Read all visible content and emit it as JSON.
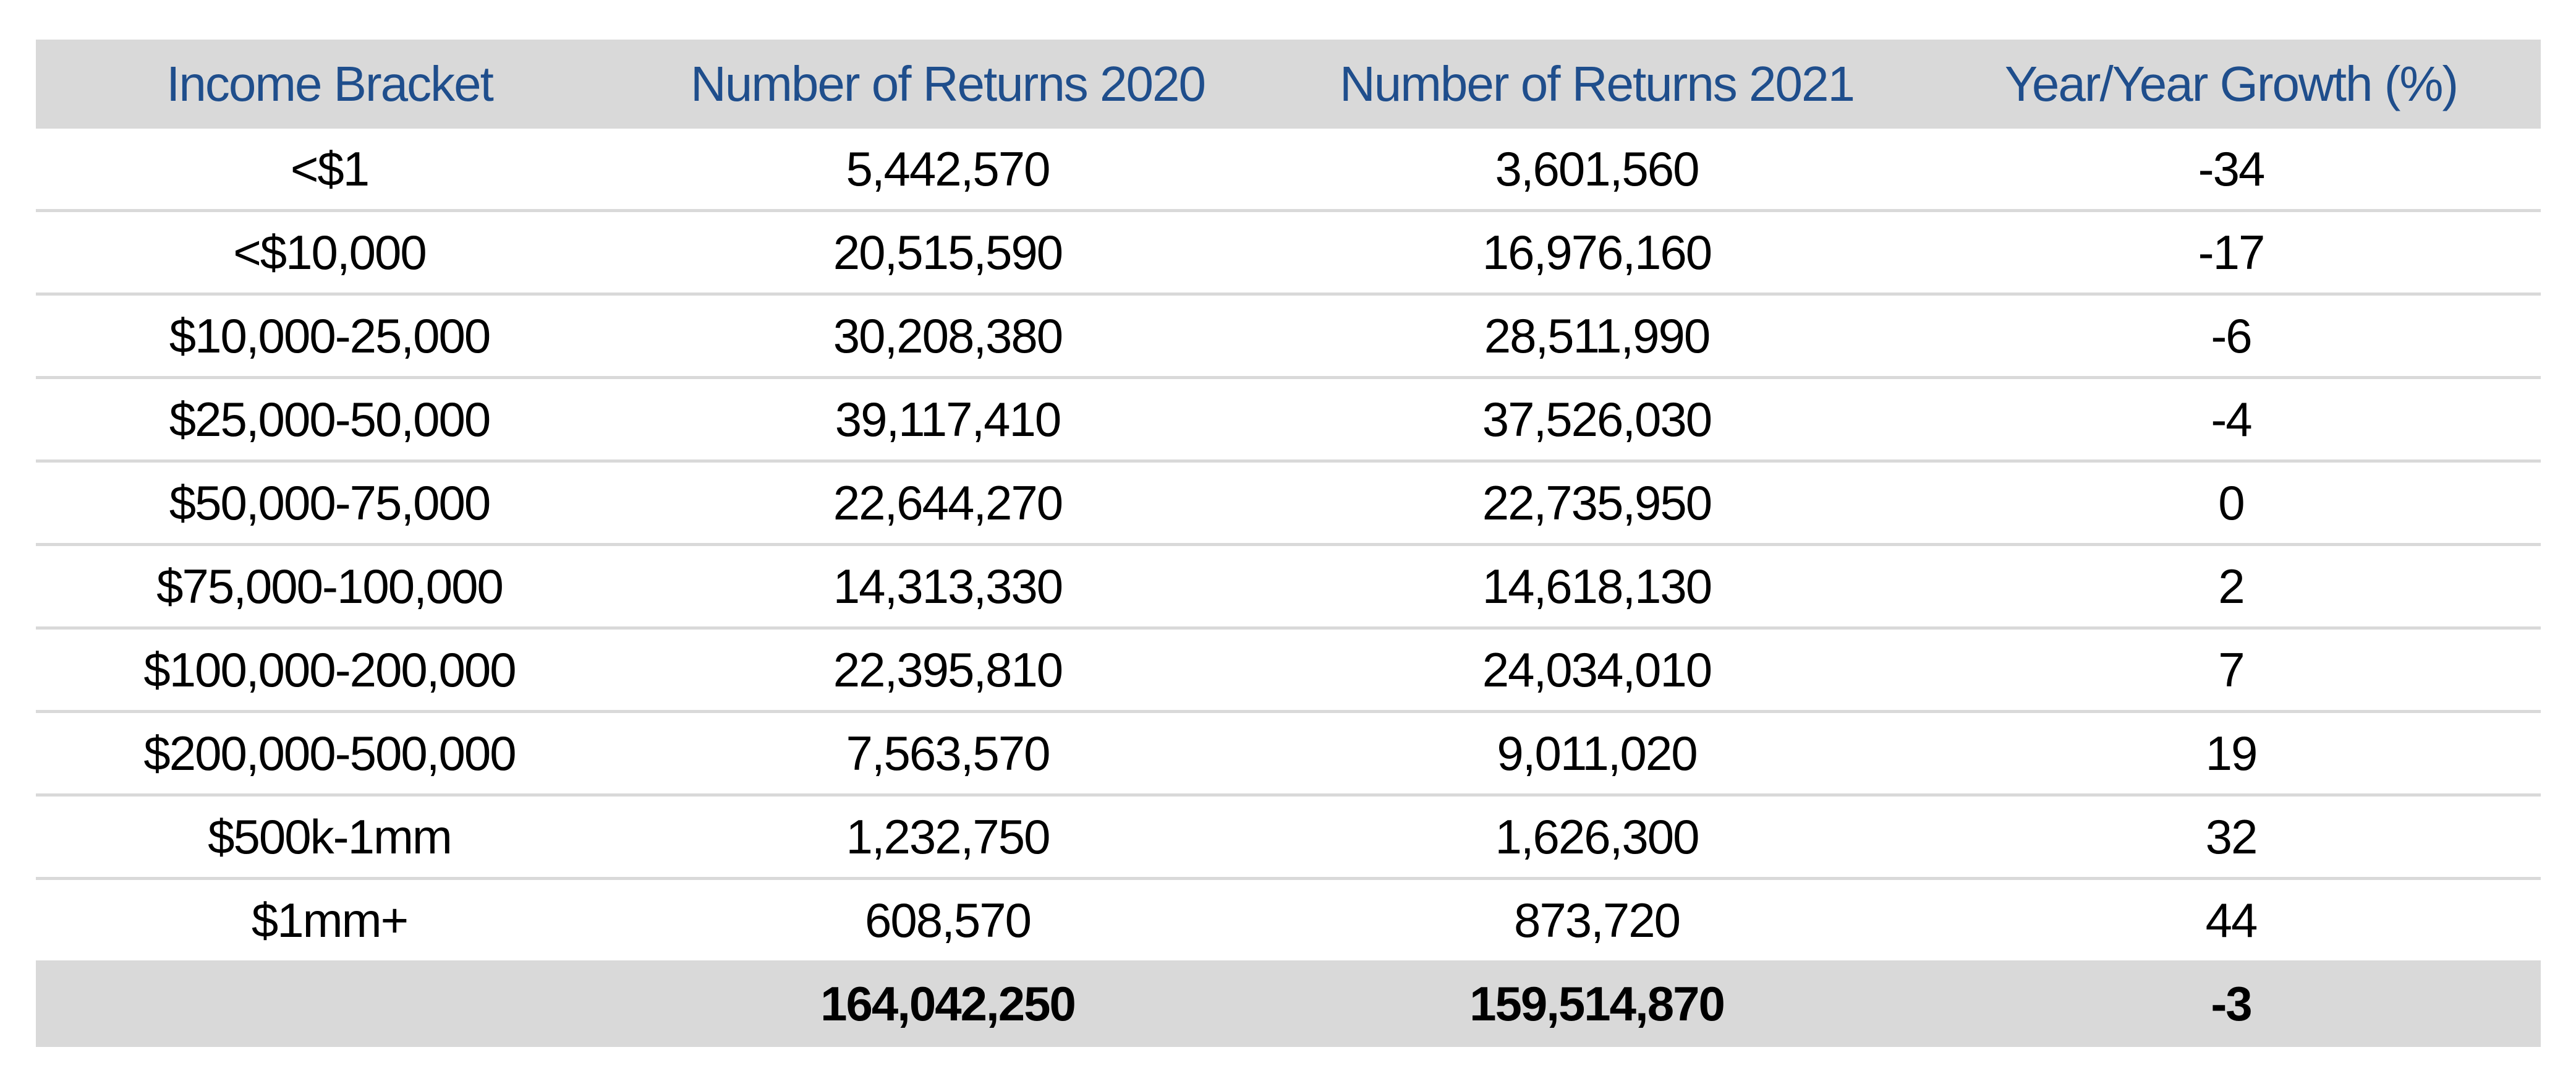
{
  "table": {
    "headers": [
      "Income Bracket",
      "Number of Returns 2020",
      "Number of Returns 2021",
      "Year/Year Growth (%)"
    ],
    "rows": [
      [
        "<$1",
        "5,442,570",
        "3,601,560",
        "-34"
      ],
      [
        "<$10,000",
        "20,515,590",
        "16,976,160",
        "-17"
      ],
      [
        "$10,000-25,000",
        "30,208,380",
        "28,511,990",
        "-6"
      ],
      [
        "$25,000-50,000",
        "39,117,410",
        "37,526,030",
        "-4"
      ],
      [
        "$50,000-75,000",
        "22,644,270",
        "22,735,950",
        "0"
      ],
      [
        "$75,000-100,000",
        "14,313,330",
        "14,618,130",
        "2"
      ],
      [
        "$100,000-200,000",
        "22,395,810",
        "24,034,010",
        "7"
      ],
      [
        "$200,000-500,000",
        "7,563,570",
        "9,011,020",
        "19"
      ],
      [
        "$500k-1mm",
        "1,232,750",
        "1,626,300",
        "32"
      ],
      [
        "$1mm+",
        "608,570",
        "873,720",
        "44"
      ]
    ],
    "total": [
      "",
      "164,042,250",
      "159,514,870",
      "-3"
    ]
  },
  "colors": {
    "header_text": "#1f4e8c",
    "header_bg": "#d9d9d9",
    "divider": "#d9d9d9"
  }
}
